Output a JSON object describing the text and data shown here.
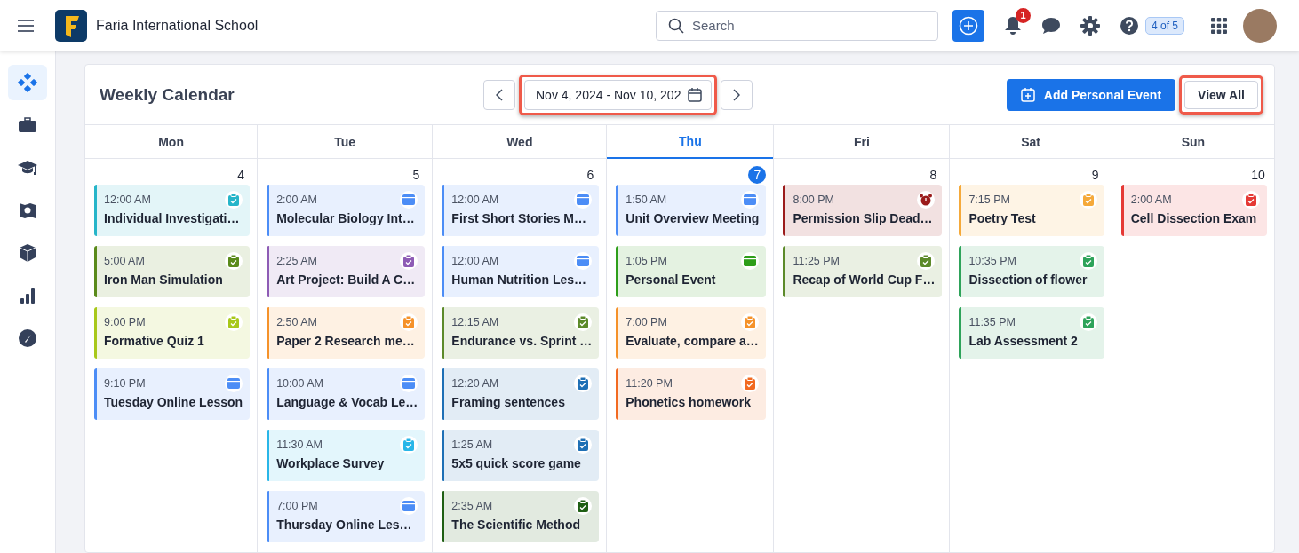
{
  "top_bar": {
    "school_name": "Faria International School",
    "search": {
      "placeholder": "Search"
    },
    "notifications_badge": "1",
    "tour_badge": "4 of 5"
  },
  "sidebar": {
    "items": [
      {
        "kind": "diamonds",
        "selected": true
      },
      {
        "kind": "briefcase",
        "selected": false
      },
      {
        "kind": "cap",
        "selected": false
      },
      {
        "kind": "map",
        "selected": false
      },
      {
        "kind": "cube",
        "selected": false
      },
      {
        "kind": "bars",
        "selected": false
      },
      {
        "kind": "compass",
        "selected": false
      }
    ]
  },
  "calendar": {
    "title": "Weekly Calendar",
    "date_range": {
      "value": "Nov 4, 2024 - Nov 10, 202",
      "highlighted": true
    },
    "add_button": "Add Personal Event",
    "view_all": {
      "label": "View All",
      "highlighted": true
    },
    "days": [
      {
        "name": "Mon",
        "date": "4",
        "selected": false,
        "events": [
          {
            "time": "12:00 AM",
            "title": "Individual Investigati…",
            "color": "#26b5c9",
            "kind": "task"
          },
          {
            "time": "5:00 AM",
            "title": "Iron Man Simulation",
            "color": "#5a8a1a",
            "kind": "task"
          },
          {
            "time": "9:00 PM",
            "title": "Formative Quiz 1",
            "color": "#a8c81a",
            "kind": "task"
          },
          {
            "time": "9:10 PM",
            "title": "Tuesday Online Lesson",
            "color": "#4c8df6",
            "kind": "event"
          }
        ]
      },
      {
        "name": "Tue",
        "date": "5",
        "selected": false,
        "events": [
          {
            "time": "2:00 AM",
            "title": "Molecular Biology Int…",
            "color": "#4c8df6",
            "kind": "event"
          },
          {
            "time": "2:25 AM",
            "title": "Art Project: Build A C…",
            "color": "#8e5cb5",
            "kind": "task"
          },
          {
            "time": "2:50 AM",
            "title": "Paper 2 Research me…",
            "color": "#f5922a",
            "kind": "task"
          },
          {
            "time": "10:00 AM",
            "title": "Language & Vocab Le…",
            "color": "#4c8df6",
            "kind": "event"
          },
          {
            "time": "11:30 AM",
            "title": "Workplace Survey",
            "color": "#29b6e8",
            "kind": "task"
          },
          {
            "time": "7:00 PM",
            "title": "Thursday Online Les…",
            "color": "#4c8df6",
            "kind": "event"
          }
        ]
      },
      {
        "name": "Wed",
        "date": "6",
        "selected": false,
        "events": [
          {
            "time": "12:00 AM",
            "title": "First Short Stories M…",
            "color": "#4c8df6",
            "kind": "event"
          },
          {
            "time": "12:00 AM",
            "title": "Human Nutrition Les…",
            "color": "#4c8df6",
            "kind": "event"
          },
          {
            "time": "12:15 AM",
            "title": "Endurance vs. Sprint …",
            "color": "#5c8a2a",
            "kind": "task"
          },
          {
            "time": "12:20 AM",
            "title": "Framing sentences",
            "color": "#1e6fb5",
            "kind": "task"
          },
          {
            "time": "1:25 AM",
            "title": "5x5 quick score game",
            "color": "#1e6fb5",
            "kind": "task"
          },
          {
            "time": "2:35 AM",
            "title": "The Scientific Method",
            "color": "#1f5f14",
            "kind": "task"
          }
        ]
      },
      {
        "name": "Thu",
        "date": "7",
        "selected": true,
        "events": [
          {
            "time": "1:50 AM",
            "title": "Unit Overview Meeting",
            "color": "#4c8df6",
            "kind": "event"
          },
          {
            "time": "1:05 PM",
            "title": "Personal Event",
            "color": "#2e9e1a",
            "kind": "event"
          },
          {
            "time": "7:00 PM",
            "title": "Evaluate, compare a…",
            "color": "#f5922a",
            "kind": "task"
          },
          {
            "time": "11:20 PM",
            "title": "Phonetics homework",
            "color": "#f26a21",
            "kind": "task"
          }
        ]
      },
      {
        "name": "Fri",
        "date": "8",
        "selected": false,
        "events": [
          {
            "time": "8:00 PM",
            "title": "Permission Slip Dead…",
            "color": "#9b1b1b",
            "kind": "deadline"
          },
          {
            "time": "11:25 PM",
            "title": "Recap of World Cup F…",
            "color": "#5c8a2a",
            "kind": "task"
          }
        ]
      },
      {
        "name": "Sat",
        "date": "9",
        "selected": false,
        "events": [
          {
            "time": "7:15 PM",
            "title": "Poetry Test",
            "color": "#f5a93a",
            "kind": "task"
          },
          {
            "time": "10:35 PM",
            "title": "Dissection of flower",
            "color": "#2ea35a",
            "kind": "task"
          },
          {
            "time": "11:35 PM",
            "title": "Lab Assessment 2",
            "color": "#2ea35a",
            "kind": "task"
          }
        ]
      },
      {
        "name": "Sun",
        "date": "10",
        "selected": false,
        "events": [
          {
            "time": "2:00 AM",
            "title": "Cell Dissection Exam",
            "color": "#e53935",
            "kind": "task"
          }
        ]
      }
    ]
  }
}
